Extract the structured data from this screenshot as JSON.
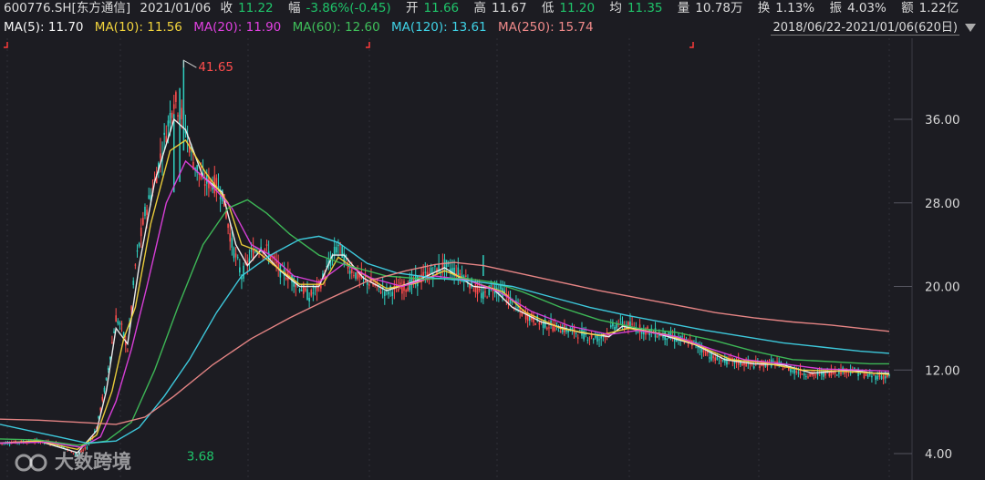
{
  "header": {
    "code": "600776.SH[东方通信]",
    "date": "2021/01/06",
    "close_label": "收",
    "close": "11.22",
    "change_label": "幅",
    "change": "-3.86%(-0.45)",
    "open_label": "开",
    "open": "11.66",
    "high_label": "高",
    "high": "11.67",
    "low_label": "低",
    "low": "11.20",
    "avg_label": "均",
    "avg": "11.35",
    "vol_label": "量",
    "vol": "10.78万",
    "turnover_label": "换",
    "turnover": "1.13%",
    "amp_label": "振",
    "amp": "4.03%",
    "amount_label": "额",
    "amount": "1.22亿"
  },
  "ma_legend": [
    {
      "label": "MA(5): 11.70",
      "color": "#f5f5f5"
    },
    {
      "label": "MA(10): 11.56",
      "color": "#f2d43c"
    },
    {
      "label": "MA(20): 11.90",
      "color": "#e040e0"
    },
    {
      "label": "MA(60): 12.60",
      "color": "#3fbf5a"
    },
    {
      "label": "MA(120): 13.61",
      "color": "#3fd2e6"
    },
    {
      "label": "MA(250): 15.74",
      "color": "#f08a8a"
    }
  ],
  "range": "2018/06/22-2021/01/06(620日)",
  "watermark": "大数跨境",
  "chart_data": {
    "type": "line",
    "yticks": [
      "36.00",
      "28.00",
      "20.00",
      "12.00",
      "4.00"
    ],
    "ytick_values": [
      36,
      28,
      20,
      12,
      4
    ],
    "ylim": [
      1.5,
      45
    ],
    "bars": 620,
    "max_label": "41.65",
    "max_value": 41.65,
    "max_index": 95,
    "min_label": "3.68",
    "min_value": 3.68,
    "min_index": 40,
    "price": [
      [
        0,
        5.0
      ],
      [
        10,
        5.1
      ],
      [
        20,
        5.2
      ],
      [
        30,
        4.9
      ],
      [
        40,
        3.9
      ],
      [
        45,
        4.6
      ],
      [
        50,
        6.5
      ],
      [
        55,
        11
      ],
      [
        60,
        17
      ],
      [
        63,
        16
      ],
      [
        66,
        14
      ],
      [
        70,
        22
      ],
      [
        75,
        27
      ],
      [
        80,
        30
      ],
      [
        85,
        34
      ],
      [
        90,
        38
      ],
      [
        95,
        36
      ],
      [
        100,
        32
      ],
      [
        105,
        30
      ],
      [
        110,
        30
      ],
      [
        115,
        29
      ],
      [
        120,
        24
      ],
      [
        125,
        21
      ],
      [
        130,
        23
      ],
      [
        135,
        24
      ],
      [
        140,
        23
      ],
      [
        145,
        21.5
      ],
      [
        150,
        21
      ],
      [
        155,
        20
      ],
      [
        160,
        19
      ],
      [
        165,
        20
      ],
      [
        170,
        22
      ],
      [
        175,
        24
      ],
      [
        180,
        22
      ],
      [
        185,
        21
      ],
      [
        190,
        20.5
      ],
      [
        200,
        19.5
      ],
      [
        210,
        20
      ],
      [
        220,
        21
      ],
      [
        230,
        22
      ],
      [
        240,
        21
      ],
      [
        250,
        19
      ],
      [
        255,
        20
      ],
      [
        260,
        19.5
      ],
      [
        270,
        17.5
      ],
      [
        280,
        16.5
      ],
      [
        290,
        16
      ],
      [
        300,
        15.5
      ],
      [
        310,
        15
      ],
      [
        320,
        16.5
      ],
      [
        330,
        16
      ],
      [
        340,
        15.5
      ],
      [
        350,
        15
      ],
      [
        360,
        14.5
      ],
      [
        370,
        13
      ],
      [
        380,
        12.8
      ],
      [
        390,
        12.5
      ],
      [
        400,
        12.7
      ],
      [
        410,
        12
      ],
      [
        420,
        11.5
      ],
      [
        430,
        11.8
      ],
      [
        440,
        12
      ],
      [
        450,
        11.4
      ],
      [
        460,
        11.4
      ]
    ],
    "series": [
      {
        "name": "MA(5)",
        "color": "#f5f5f5",
        "points": [
          [
            0,
            5.0
          ],
          [
            20,
            5.2
          ],
          [
            40,
            4.1
          ],
          [
            50,
            6.2
          ],
          [
            55,
            10
          ],
          [
            60,
            16
          ],
          [
            66,
            14.5
          ],
          [
            72,
            22
          ],
          [
            80,
            30
          ],
          [
            90,
            36
          ],
          [
            96,
            35
          ],
          [
            105,
            30.5
          ],
          [
            115,
            29
          ],
          [
            122,
            24
          ],
          [
            128,
            22
          ],
          [
            135,
            23.5
          ],
          [
            145,
            21.5
          ],
          [
            155,
            20
          ],
          [
            165,
            20
          ],
          [
            172,
            23
          ],
          [
            178,
            23
          ],
          [
            188,
            20.8
          ],
          [
            200,
            19.6
          ],
          [
            215,
            20.5
          ],
          [
            230,
            21.8
          ],
          [
            245,
            20
          ],
          [
            255,
            19.8
          ],
          [
            265,
            18
          ],
          [
            280,
            16.6
          ],
          [
            300,
            15.6
          ],
          [
            315,
            15.2
          ],
          [
            322,
            16.2
          ],
          [
            340,
            15.5
          ],
          [
            360,
            14.4
          ],
          [
            375,
            13
          ],
          [
            390,
            12.6
          ],
          [
            405,
            12.5
          ],
          [
            420,
            11.7
          ],
          [
            440,
            12
          ],
          [
            452,
            11.7
          ],
          [
            460,
            11.7
          ]
        ]
      },
      {
        "name": "MA(10)",
        "color": "#f2d43c",
        "points": [
          [
            0,
            5.0
          ],
          [
            20,
            5.2
          ],
          [
            40,
            4.4
          ],
          [
            50,
            5.8
          ],
          [
            58,
            10
          ],
          [
            64,
            15
          ],
          [
            70,
            18
          ],
          [
            78,
            26
          ],
          [
            88,
            33
          ],
          [
            96,
            34
          ],
          [
            106,
            31
          ],
          [
            118,
            28
          ],
          [
            125,
            24
          ],
          [
            132,
            23.5
          ],
          [
            142,
            22
          ],
          [
            155,
            20.2
          ],
          [
            167,
            20.2
          ],
          [
            175,
            22.8
          ],
          [
            185,
            21.5
          ],
          [
            200,
            19.8
          ],
          [
            215,
            20.3
          ],
          [
            230,
            21.5
          ],
          [
            248,
            20.2
          ],
          [
            260,
            19.5
          ],
          [
            272,
            17.5
          ],
          [
            290,
            16
          ],
          [
            310,
            15.3
          ],
          [
            325,
            16
          ],
          [
            345,
            15.4
          ],
          [
            362,
            14.3
          ],
          [
            378,
            13
          ],
          [
            395,
            12.7
          ],
          [
            415,
            12
          ],
          [
            435,
            11.9
          ],
          [
            452,
            11.7
          ],
          [
            460,
            11.56
          ]
        ]
      },
      {
        "name": "MA(20)",
        "color": "#e040e0",
        "points": [
          [
            0,
            5.0
          ],
          [
            25,
            5.1
          ],
          [
            42,
            4.6
          ],
          [
            52,
            5.6
          ],
          [
            60,
            9
          ],
          [
            68,
            14
          ],
          [
            76,
            20
          ],
          [
            86,
            28
          ],
          [
            96,
            32
          ],
          [
            108,
            30
          ],
          [
            120,
            27.5
          ],
          [
            130,
            24
          ],
          [
            140,
            23
          ],
          [
            152,
            21
          ],
          [
            165,
            20.4
          ],
          [
            178,
            22.2
          ],
          [
            192,
            20.8
          ],
          [
            208,
            20
          ],
          [
            225,
            21
          ],
          [
            242,
            20.6
          ],
          [
            258,
            19.5
          ],
          [
            275,
            17.6
          ],
          [
            295,
            16.2
          ],
          [
            315,
            15.4
          ],
          [
            330,
            15.8
          ],
          [
            350,
            15.2
          ],
          [
            368,
            14
          ],
          [
            385,
            13
          ],
          [
            405,
            12.6
          ],
          [
            425,
            12.1
          ],
          [
            445,
            12
          ],
          [
            460,
            11.9
          ]
        ]
      },
      {
        "name": "MA(60)",
        "color": "#3fbf5a",
        "points": [
          [
            0,
            5.4
          ],
          [
            20,
            5.3
          ],
          [
            40,
            4.8
          ],
          [
            55,
            5.2
          ],
          [
            68,
            7
          ],
          [
            80,
            12
          ],
          [
            92,
            18
          ],
          [
            105,
            24
          ],
          [
            118,
            27.5
          ],
          [
            128,
            28.3
          ],
          [
            138,
            27
          ],
          [
            150,
            25
          ],
          [
            165,
            23
          ],
          [
            180,
            22
          ],
          [
            200,
            21
          ],
          [
            220,
            20.7
          ],
          [
            240,
            20.8
          ],
          [
            255,
            20.4
          ],
          [
            270,
            19.5
          ],
          [
            290,
            18
          ],
          [
            310,
            16.8
          ],
          [
            330,
            16
          ],
          [
            350,
            15.6
          ],
          [
            370,
            14.8
          ],
          [
            390,
            13.8
          ],
          [
            410,
            13
          ],
          [
            430,
            12.8
          ],
          [
            450,
            12.6
          ],
          [
            460,
            12.6
          ]
        ]
      },
      {
        "name": "MA(120)",
        "color": "#3fd2e6",
        "points": [
          [
            0,
            6.8
          ],
          [
            15,
            6.2
          ],
          [
            30,
            5.6
          ],
          [
            45,
            5
          ],
          [
            60,
            5.2
          ],
          [
            72,
            6.5
          ],
          [
            85,
            9.5
          ],
          [
            98,
            13
          ],
          [
            112,
            17.5
          ],
          [
            125,
            21
          ],
          [
            140,
            23
          ],
          [
            155,
            24.5
          ],
          [
            165,
            24.8
          ],
          [
            175,
            24.2
          ],
          [
            190,
            22.2
          ],
          [
            205,
            21.3
          ],
          [
            225,
            20.8
          ],
          [
            245,
            20.5
          ],
          [
            265,
            20
          ],
          [
            285,
            19
          ],
          [
            305,
            18
          ],
          [
            325,
            17.2
          ],
          [
            345,
            16.5
          ],
          [
            365,
            15.8
          ],
          [
            385,
            15.2
          ],
          [
            405,
            14.6
          ],
          [
            425,
            14.2
          ],
          [
            445,
            13.8
          ],
          [
            460,
            13.6
          ]
        ]
      },
      {
        "name": "MA(250)",
        "color": "#f08a8a",
        "points": [
          [
            0,
            7.3
          ],
          [
            20,
            7.2
          ],
          [
            40,
            7.0
          ],
          [
            60,
            6.8
          ],
          [
            75,
            7.5
          ],
          [
            90,
            9.5
          ],
          [
            110,
            12.5
          ],
          [
            130,
            15
          ],
          [
            150,
            17
          ],
          [
            170,
            18.8
          ],
          [
            190,
            20.5
          ],
          [
            210,
            21.5
          ],
          [
            225,
            22.1
          ],
          [
            235,
            22.3
          ],
          [
            250,
            22
          ],
          [
            270,
            21.2
          ],
          [
            290,
            20.4
          ],
          [
            310,
            19.6
          ],
          [
            330,
            18.9
          ],
          [
            350,
            18.2
          ],
          [
            370,
            17.5
          ],
          [
            390,
            17
          ],
          [
            410,
            16.6
          ],
          [
            430,
            16.3
          ],
          [
            445,
            16
          ],
          [
            460,
            15.7
          ]
        ]
      }
    ]
  }
}
